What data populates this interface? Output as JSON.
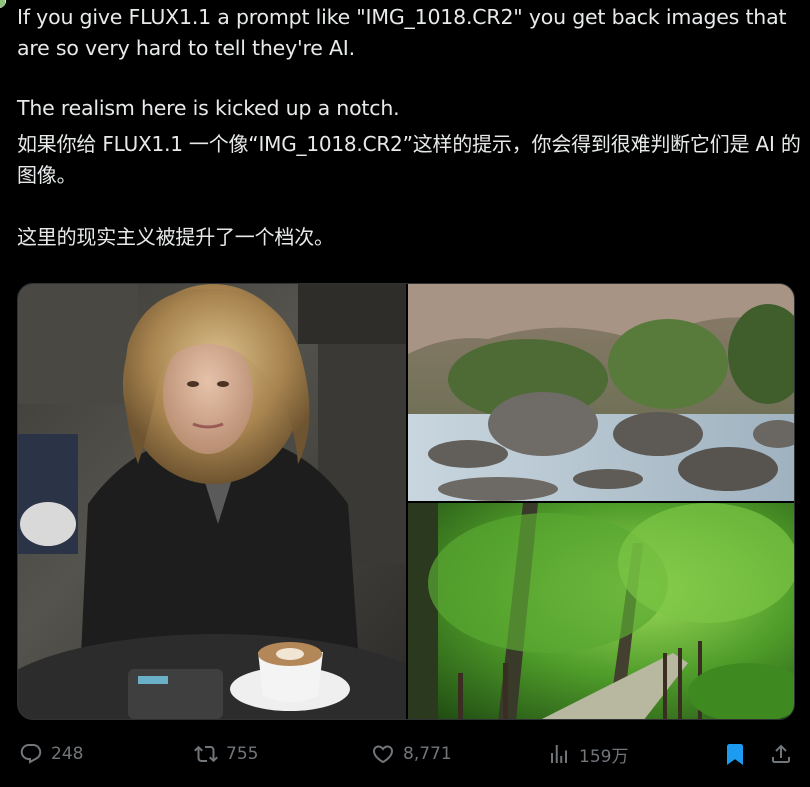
{
  "tweet": {
    "paragraphs": [
      "If you give FLUX1.1 a prompt like \"IMG_1018.CR2\" you get back images that are so very hard to tell they're AI.",
      "The realism here is kicked up a notch.",
      "如果你给 FLUX1.1 一个像“IMG_1018.CR2”这样的提示，你会得到很难判断它们是 AI 的图像。",
      "这里的现实主义被提升了一个档次。"
    ]
  },
  "media": [
    {
      "name": "woman-cafe-photo"
    },
    {
      "name": "mountain-river-photo"
    },
    {
      "name": "forest-path-photo"
    }
  ],
  "actions": {
    "replies": "248",
    "retweets": "755",
    "likes": "8,771",
    "views": "159万"
  },
  "colors": {
    "background": "#000000",
    "text": "#e7e9ea",
    "muted": "#71767b",
    "accent": "#1d9bf0"
  }
}
